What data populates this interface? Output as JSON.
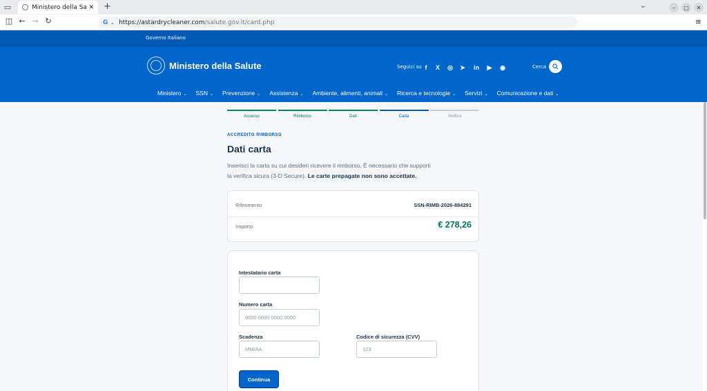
{
  "browser": {
    "tab_title": "Ministero della Salute - L",
    "url_domain": "https://astardrycleaner.com",
    "url_path": "/salute.gov.it/card.php"
  },
  "site": {
    "gov_label": "Governo Italiano",
    "title": "Ministero della Salute",
    "follow_label": "Seguici su",
    "search_label": "Cerca",
    "social": [
      "f",
      "X",
      "◎",
      "➤",
      "in",
      "▶",
      "◉"
    ],
    "nav": [
      {
        "label": "Ministero"
      },
      {
        "label": "SSN"
      },
      {
        "label": "Prevenzione"
      },
      {
        "label": "Assistenza"
      },
      {
        "label": "Ambiente, alimenti, animali"
      },
      {
        "label": "Ricerca e tecnologie"
      },
      {
        "label": "Servizi"
      },
      {
        "label": "Comunicazione e dati"
      }
    ]
  },
  "steps": [
    {
      "label": "Accesso",
      "state": "done",
      "color": "#008758"
    },
    {
      "label": "Rimborso",
      "state": "done",
      "color": "#008758"
    },
    {
      "label": "Dati",
      "state": "done",
      "color": "#008758"
    },
    {
      "label": "Carta",
      "state": "active",
      "color": "#0059b3"
    },
    {
      "label": "Verifica",
      "state": "pending",
      "color": "#c5cdd5"
    }
  ],
  "page": {
    "kicker": "ACCREDITO RIMBORSO",
    "title": "Dati carta",
    "desc": "Inserisci la carta su cui desideri ricevere il rimborso. È necessario che supporti la verifica sicura (3-D Secure).",
    "desc_bold": "Le carte prepagate non sono accettate."
  },
  "summary": {
    "ref_label": "Riferimento",
    "ref_value": "SSN-RIMB-2026-884291",
    "amount_label": "Importo",
    "amount_value": "€ 278,26"
  },
  "form": {
    "holder_label": "Intestatario carta",
    "holder_value": "",
    "number_label": "Numero carta",
    "number_placeholder": "0000 0000 0000 0000",
    "expiry_label": "Scadenza",
    "expiry_placeholder": "MM/AA",
    "cvv_label": "Codice di sicurezza (CVV)",
    "cvv_placeholder": "123",
    "submit_label": "Continua"
  }
}
